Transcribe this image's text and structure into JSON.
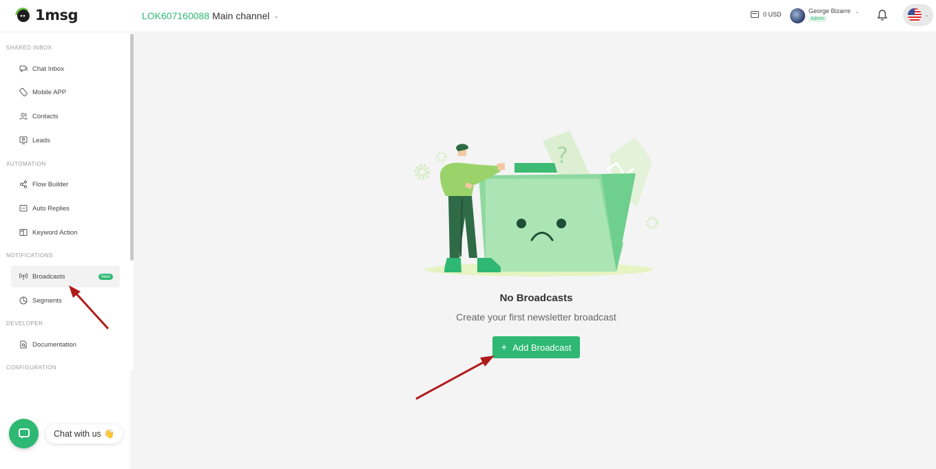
{
  "header": {
    "logo_text": "1msg",
    "channel_id": "LOK607160088",
    "channel_name": "Main channel",
    "balance": "0 USD",
    "user_name": "George Bizarre",
    "user_role": "Admin"
  },
  "sidebar": {
    "sections": {
      "shared_inbox": "SHARED INBOX",
      "automation": "AUTOMATION",
      "notifications": "NOTIFICATIONS",
      "developer": "DEVELOPER",
      "configuration": "CONFIGURATION"
    },
    "items": [
      {
        "label": "Chat Inbox",
        "icon": "chat-inbox-icon"
      },
      {
        "label": "Mobile APP",
        "icon": "mobile-app-icon"
      },
      {
        "label": "Contacts",
        "icon": "contacts-icon"
      },
      {
        "label": "Leads",
        "icon": "leads-icon"
      },
      {
        "label": "Flow Builder",
        "icon": "flow-builder-icon"
      },
      {
        "label": "Auto Replies",
        "icon": "auto-replies-icon"
      },
      {
        "label": "Keyword Action",
        "icon": "keyword-action-icon"
      },
      {
        "label": "Broadcasts",
        "icon": "broadcast-icon",
        "badge": "New",
        "active": true
      },
      {
        "label": "Segments",
        "icon": "segments-icon"
      },
      {
        "label": "Documentation",
        "icon": "documentation-icon"
      }
    ]
  },
  "chat_widget": {
    "label": "Chat with us",
    "emoji": "👋"
  },
  "main": {
    "empty_title": "No Broadcasts",
    "empty_subtitle": "Create your first newsletter broadcast",
    "add_button_label": "Add Broadcast",
    "add_button_icon": "+"
  },
  "colors": {
    "accent": "#2eb873",
    "annotation_arrow": "#b01a1a"
  }
}
